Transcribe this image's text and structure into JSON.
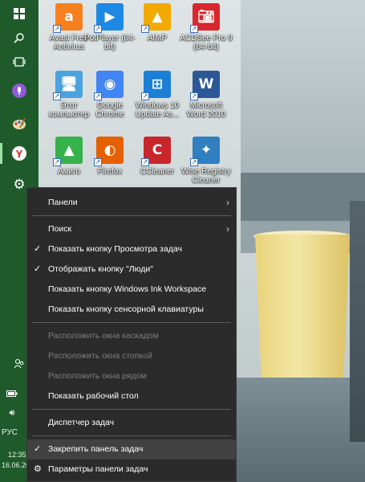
{
  "desktop_icons": [
    {
      "label": "Avast Free Antivirus",
      "icon": "avast-icon",
      "color": "#f7801e"
    },
    {
      "label": "PotPlayer (64-bit)",
      "icon": "potplayer-icon",
      "color": "#1e88e5"
    },
    {
      "label": "AIMP",
      "icon": "aimp-icon",
      "color": "#f2a900"
    },
    {
      "label": "ACDSee Pro 9 (64-bit)",
      "icon": "acdsee-icon",
      "color": "#d8272d"
    },
    {
      "label": "Этот компьютер",
      "icon": "computer-icon",
      "color": "#4aa3df"
    },
    {
      "label": "Google Chrome",
      "icon": "chrome-icon",
      "color": "#4285f4"
    },
    {
      "label": "Windows 10 Update As...",
      "icon": "windows-update-icon",
      "color": "#1b7fd6"
    },
    {
      "label": "Microsoft Word 2010",
      "icon": "word-icon",
      "color": "#2b5797"
    },
    {
      "label": "Амиго",
      "icon": "amigo-icon",
      "color": "#36b24a"
    },
    {
      "label": "Firefox",
      "icon": "firefox-icon",
      "color": "#e66000"
    },
    {
      "label": "CCleaner",
      "icon": "ccleaner-icon",
      "color": "#c8262b"
    },
    {
      "label": "Wise Registry Cleaner",
      "icon": "wise-registry-icon",
      "color": "#2f7fc1"
    }
  ],
  "sidebar": {
    "icons": [
      "windows-logo-icon",
      "search-icon",
      "task-view-icon",
      "cortana-icon",
      "paint-icon",
      "yandex-browser-icon",
      "gear-icon"
    ],
    "people_icon": "people-icon",
    "battery_icon": "battery-icon",
    "volume_icon": "volume-icon",
    "language": "РУС",
    "time": "12:35",
    "date": "16.06.20"
  },
  "menu": {
    "groups": [
      [
        {
          "label": "Панели",
          "submenu": true
        }
      ],
      [
        {
          "label": "Поиск",
          "submenu": true
        },
        {
          "label": "Показать кнопку Просмотра задач",
          "checked": true
        },
        {
          "label": "Отображать кнопку \"Люди\"",
          "checked": true
        },
        {
          "label": "Показать кнопку Windows Ink Workspace"
        },
        {
          "label": "Показать кнопку сенсорной клавиатуры"
        }
      ],
      [
        {
          "label": "Расположить окна каскадом",
          "disabled": true
        },
        {
          "label": "Расположить окна стопкой",
          "disabled": true
        },
        {
          "label": "Расположить окна рядом",
          "disabled": true
        },
        {
          "label": "Показать рабочий стол"
        }
      ],
      [
        {
          "label": "Диспетчер задач"
        }
      ],
      [
        {
          "label": "Закрепить панель задач",
          "checked": true,
          "hover": true
        },
        {
          "label": "Параметры панели задач",
          "gear": true
        }
      ]
    ]
  },
  "colors": {
    "sidebar_bg": "#1f5a2a",
    "menu_bg": "#2b2b2b",
    "menu_hover": "#414141",
    "menu_text": "#ffffff",
    "menu_disabled": "#7d7d7d"
  }
}
